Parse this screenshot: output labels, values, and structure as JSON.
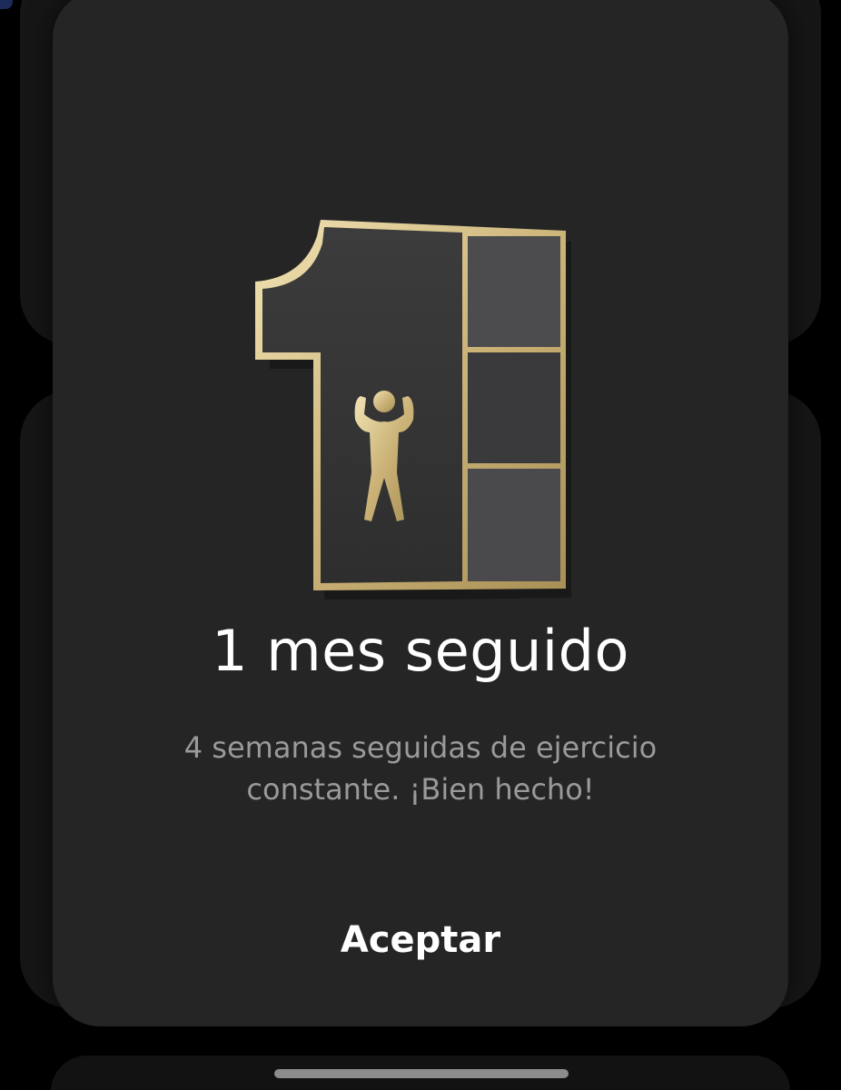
{
  "dialog": {
    "title": "1 mes seguido",
    "description": "4 semanas seguidas de ejercicio constante. ¡Bien hecho!",
    "accept_label": "Aceptar"
  },
  "badge": {
    "icon": "streak-one-month-badge",
    "figure_icon": "flexing-person-icon",
    "weeks_completed": 4,
    "gold": "#d8c48f",
    "panel": "#3a3a3a",
    "segment": "#4a4a4a"
  }
}
